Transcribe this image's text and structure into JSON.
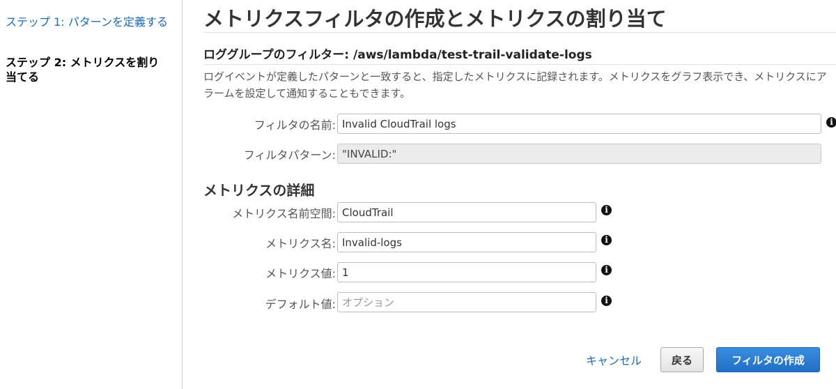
{
  "sidebar": {
    "steps": [
      {
        "label": "ステップ 1: パターンを定義する"
      },
      {
        "label": "ステップ 2: メトリクスを割り当てる"
      }
    ]
  },
  "main": {
    "title": "メトリクスフィルタの作成とメトリクスの割り当て",
    "subtitle": "ロググループのフィルター: /aws/lambda/test-trail-validate-logs",
    "description": "ログイベントが定義したパターンと一致すると、指定したメトリクスに記録されます。メトリクスをグラフ表示でき、メトリクスにアラームを設定して通知することもできます。",
    "filter_name": {
      "label": "フィルタの名前:",
      "value": "Invalid CloudTrail logs"
    },
    "filter_pattern": {
      "label": "フィルタパターン:",
      "value": "\"INVALID:\""
    },
    "metric_section_title": "メトリクスの詳細",
    "metric_namespace": {
      "label": "メトリクス名前空間:",
      "value": "CloudTrail"
    },
    "metric_name": {
      "label": "メトリクス名:",
      "value": "Invalid-logs"
    },
    "metric_value": {
      "label": "メトリクス値:",
      "value": "1"
    },
    "default_value": {
      "label": "デフォルト値:",
      "value": "",
      "placeholder": "オプション"
    },
    "info_glyph": "i"
  },
  "actions": {
    "cancel_label": "キャンセル",
    "back_label": "戻る",
    "create_label": "フィルタの作成"
  },
  "colors": {
    "link": "#1a6bb8",
    "primary_button": "#2a7dd6"
  },
  "icons": {
    "info": "info-icon"
  }
}
